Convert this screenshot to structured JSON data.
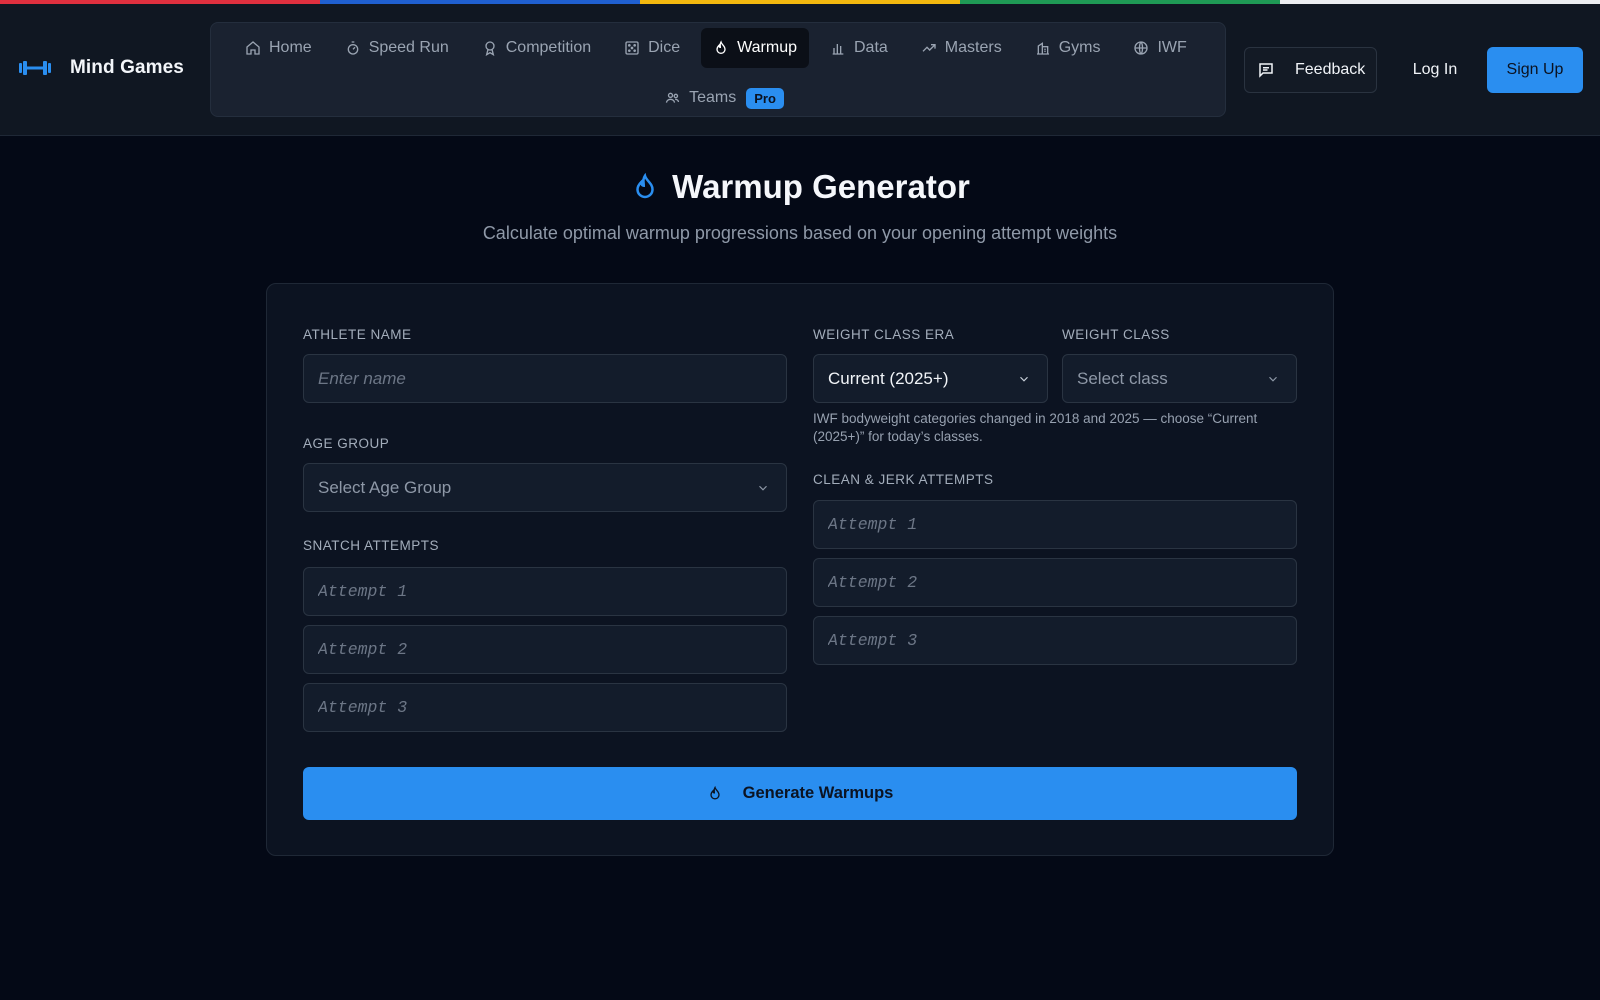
{
  "colors": {
    "stripe": [
      "#e0303f",
      "#1f5fd0",
      "#f2b80f",
      "#1f9a55",
      "#eceef1"
    ],
    "accent": "#2a8ef0",
    "background": "#040916"
  },
  "brand": {
    "name": "Mind Games",
    "icon": "barbell-icon"
  },
  "nav": {
    "items": [
      {
        "label": "Home",
        "icon": "home-icon"
      },
      {
        "label": "Speed Run",
        "icon": "stopwatch-icon"
      },
      {
        "label": "Competition",
        "icon": "medal-icon"
      },
      {
        "label": "Dice",
        "icon": "dice-icon"
      },
      {
        "label": "Warmup",
        "icon": "flame-icon",
        "active": true
      },
      {
        "label": "Data",
        "icon": "bar-chart-icon"
      },
      {
        "label": "Masters",
        "icon": "trending-up-icon"
      },
      {
        "label": "Gyms",
        "icon": "building-icon"
      },
      {
        "label": "IWF",
        "icon": "globe-icon"
      }
    ],
    "teams": {
      "label": "Teams",
      "icon": "users-icon",
      "badge": "Pro"
    }
  },
  "header_actions": {
    "feedback": "Feedback",
    "login": "Log In",
    "signup": "Sign Up"
  },
  "page": {
    "title": "Warmup Generator",
    "subtitle": "Calculate optimal warmup progressions based on your opening attempt weights"
  },
  "form": {
    "athlete_name": {
      "label": "ATHLETE NAME",
      "placeholder": "Enter name",
      "value": ""
    },
    "age_group": {
      "label": "AGE GROUP",
      "placeholder": "Select Age Group"
    },
    "weight_class_era": {
      "label": "WEIGHT CLASS ERA",
      "value": "Current (2025+)"
    },
    "weight_class": {
      "label": "WEIGHT CLASS",
      "placeholder": "Select class"
    },
    "era_hint": "IWF bodyweight categories changed in 2018 and 2025 — choose “Current (2025+)” for today’s classes.",
    "snatch": {
      "label": "SNATCH ATTEMPTS",
      "attempts": [
        {
          "placeholder": "Attempt 1"
        },
        {
          "placeholder": "Attempt 2"
        },
        {
          "placeholder": "Attempt 3"
        }
      ]
    },
    "clean_jerk": {
      "label": "CLEAN & JERK ATTEMPTS",
      "attempts": [
        {
          "placeholder": "Attempt 1"
        },
        {
          "placeholder": "Attempt 2"
        },
        {
          "placeholder": "Attempt 3"
        }
      ]
    },
    "submit": "Generate Warmups"
  }
}
